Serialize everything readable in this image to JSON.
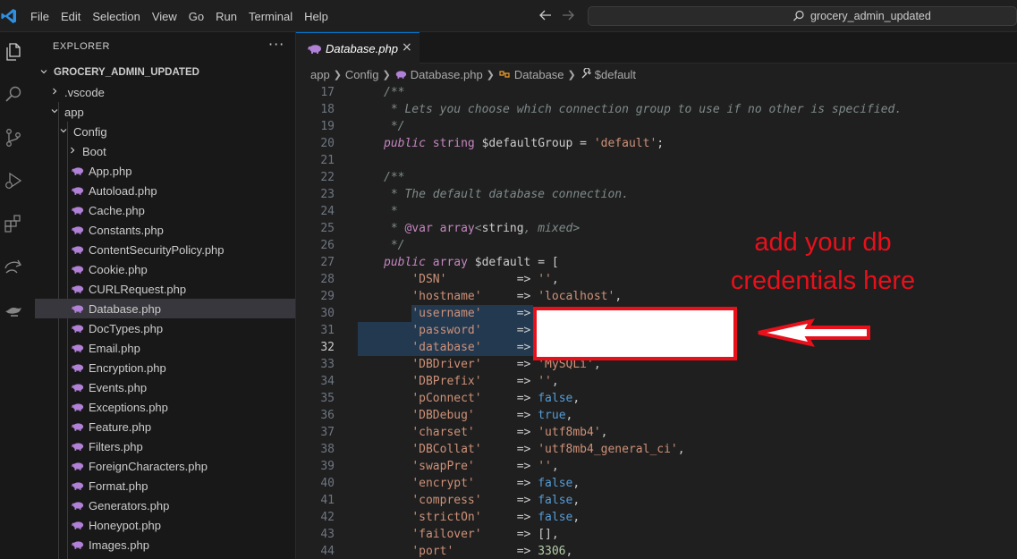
{
  "menu": [
    "File",
    "Edit",
    "Selection",
    "View",
    "Go",
    "Run",
    "Terminal",
    "Help"
  ],
  "search": {
    "text": "grocery_admin_updated"
  },
  "sidebar": {
    "title": "EXPLORER",
    "more": "···",
    "root": "GROCERY_ADMIN_UPDATED",
    "items": [
      {
        "label": ".vscode",
        "kind": "folder-collapsed"
      },
      {
        "label": "app",
        "kind": "folder-open"
      },
      {
        "label": "Config",
        "kind": "folder-open"
      },
      {
        "label": "Boot",
        "kind": "folder-collapsed"
      },
      {
        "label": "App.php",
        "kind": "php"
      },
      {
        "label": "Autoload.php",
        "kind": "php"
      },
      {
        "label": "Cache.php",
        "kind": "php"
      },
      {
        "label": "Constants.php",
        "kind": "php"
      },
      {
        "label": "ContentSecurityPolicy.php",
        "kind": "php"
      },
      {
        "label": "Cookie.php",
        "kind": "php"
      },
      {
        "label": "CURLRequest.php",
        "kind": "php"
      },
      {
        "label": "Database.php",
        "kind": "php",
        "selected": true
      },
      {
        "label": "DocTypes.php",
        "kind": "php"
      },
      {
        "label": "Email.php",
        "kind": "php"
      },
      {
        "label": "Encryption.php",
        "kind": "php"
      },
      {
        "label": "Events.php",
        "kind": "php"
      },
      {
        "label": "Exceptions.php",
        "kind": "php"
      },
      {
        "label": "Feature.php",
        "kind": "php"
      },
      {
        "label": "Filters.php",
        "kind": "php"
      },
      {
        "label": "ForeignCharacters.php",
        "kind": "php"
      },
      {
        "label": "Format.php",
        "kind": "php"
      },
      {
        "label": "Generators.php",
        "kind": "php"
      },
      {
        "label": "Honeypot.php",
        "kind": "php"
      },
      {
        "label": "Images.php",
        "kind": "php"
      }
    ]
  },
  "tab": {
    "label": "Database.php",
    "close": "×"
  },
  "breadcrumb": {
    "app": "app",
    "config": "Config",
    "file": "Database.php",
    "class": "Database",
    "prop": "$default"
  },
  "code": {
    "active_line": "32",
    "lines": [
      {
        "n": "17",
        "t": [
          [
            "c-gray",
            "/**"
          ]
        ]
      },
      {
        "n": "18",
        "t": [
          [
            "c-gray",
            " * Lets you choose which connection group to use if no other is specified."
          ]
        ]
      },
      {
        "n": "19",
        "t": [
          [
            "c-gray",
            " */"
          ]
        ]
      },
      {
        "n": "20",
        "t": [
          [
            "c-kw",
            "public"
          ],
          [
            "c-op",
            " "
          ],
          [
            "c-type",
            "string"
          ],
          [
            "c-var",
            " $defaultGroup "
          ],
          [
            "c-op",
            "= "
          ],
          [
            "c-str",
            "'default'"
          ],
          [
            "c-op",
            ";"
          ]
        ]
      },
      {
        "n": "21",
        "t": []
      },
      {
        "n": "22",
        "t": [
          [
            "c-gray",
            "/**"
          ]
        ]
      },
      {
        "n": "23",
        "t": [
          [
            "c-gray",
            " * The default database connection."
          ]
        ]
      },
      {
        "n": "24",
        "t": [
          [
            "c-gray",
            " *"
          ]
        ]
      },
      {
        "n": "25",
        "t": [
          [
            "c-gray",
            " * "
          ],
          [
            "c-tag",
            "@var"
          ],
          [
            "c-op",
            " "
          ],
          [
            "c-type",
            "array"
          ],
          [
            "c-gray",
            "<"
          ],
          [
            "c-var",
            "string"
          ],
          [
            "c-gray",
            ", mixed>"
          ]
        ]
      },
      {
        "n": "26",
        "t": [
          [
            "c-gray",
            " */"
          ]
        ]
      },
      {
        "n": "27",
        "t": [
          [
            "c-kw",
            "public"
          ],
          [
            "c-op",
            " "
          ],
          [
            "c-type",
            "array"
          ],
          [
            "c-var",
            " $default "
          ],
          [
            "c-op",
            "= ["
          ]
        ]
      },
      {
        "n": "28",
        "t": [
          [
            "c-op",
            "    "
          ],
          [
            "c-str",
            "'DSN'"
          ],
          [
            "c-op",
            "          => "
          ],
          [
            "c-str",
            "''"
          ],
          [
            "c-op",
            ","
          ]
        ]
      },
      {
        "n": "29",
        "t": [
          [
            "c-op",
            "    "
          ],
          [
            "c-str",
            "'hostname'"
          ],
          [
            "c-op",
            "     => "
          ],
          [
            "c-str",
            "'localhost'"
          ],
          [
            "c-op",
            ","
          ]
        ]
      },
      {
        "n": "30",
        "t": [
          [
            "c-op",
            "    "
          ],
          [
            "c-str",
            "'username'"
          ],
          [
            "c-op",
            "     =>"
          ]
        ]
      },
      {
        "n": "31",
        "t": [
          [
            "c-op",
            "    "
          ],
          [
            "c-str",
            "'password'"
          ],
          [
            "c-op",
            "     =>"
          ]
        ]
      },
      {
        "n": "32",
        "t": [
          [
            "c-op",
            "    "
          ],
          [
            "c-str",
            "'database'"
          ],
          [
            "c-op",
            "     =>"
          ]
        ]
      },
      {
        "n": "33",
        "t": [
          [
            "c-op",
            "    "
          ],
          [
            "c-str",
            "'DBDriver'"
          ],
          [
            "c-op",
            "     => "
          ],
          [
            "c-str",
            "'MySQLi'"
          ],
          [
            "c-op",
            ","
          ]
        ]
      },
      {
        "n": "34",
        "t": [
          [
            "c-op",
            "    "
          ],
          [
            "c-str",
            "'DBPrefix'"
          ],
          [
            "c-op",
            "     => "
          ],
          [
            "c-str",
            "''"
          ],
          [
            "c-op",
            ","
          ]
        ]
      },
      {
        "n": "35",
        "t": [
          [
            "c-op",
            "    "
          ],
          [
            "c-str",
            "'pConnect'"
          ],
          [
            "c-op",
            "     => "
          ],
          [
            "c-bool",
            "false"
          ],
          [
            "c-op",
            ","
          ]
        ]
      },
      {
        "n": "36",
        "t": [
          [
            "c-op",
            "    "
          ],
          [
            "c-str",
            "'DBDebug'"
          ],
          [
            "c-op",
            "      => "
          ],
          [
            "c-bool",
            "true"
          ],
          [
            "c-op",
            ","
          ]
        ]
      },
      {
        "n": "37",
        "t": [
          [
            "c-op",
            "    "
          ],
          [
            "c-str",
            "'charset'"
          ],
          [
            "c-op",
            "      => "
          ],
          [
            "c-str",
            "'utf8mb4'"
          ],
          [
            "c-op",
            ","
          ]
        ]
      },
      {
        "n": "38",
        "t": [
          [
            "c-op",
            "    "
          ],
          [
            "c-str",
            "'DBCollat'"
          ],
          [
            "c-op",
            "     => "
          ],
          [
            "c-str",
            "'utf8mb4_general_ci'"
          ],
          [
            "c-op",
            ","
          ]
        ]
      },
      {
        "n": "39",
        "t": [
          [
            "c-op",
            "    "
          ],
          [
            "c-str",
            "'swapPre'"
          ],
          [
            "c-op",
            "      => "
          ],
          [
            "c-str",
            "''"
          ],
          [
            "c-op",
            ","
          ]
        ]
      },
      {
        "n": "40",
        "t": [
          [
            "c-op",
            "    "
          ],
          [
            "c-str",
            "'encrypt'"
          ],
          [
            "c-op",
            "      => "
          ],
          [
            "c-bool",
            "false"
          ],
          [
            "c-op",
            ","
          ]
        ]
      },
      {
        "n": "41",
        "t": [
          [
            "c-op",
            "    "
          ],
          [
            "c-str",
            "'compress'"
          ],
          [
            "c-op",
            "     => "
          ],
          [
            "c-bool",
            "false"
          ],
          [
            "c-op",
            ","
          ]
        ]
      },
      {
        "n": "42",
        "t": [
          [
            "c-op",
            "    "
          ],
          [
            "c-str",
            "'strictOn'"
          ],
          [
            "c-op",
            "     => "
          ],
          [
            "c-bool",
            "false"
          ],
          [
            "c-op",
            ","
          ]
        ]
      },
      {
        "n": "43",
        "t": [
          [
            "c-op",
            "    "
          ],
          [
            "c-str",
            "'failover'"
          ],
          [
            "c-op",
            "     => "
          ],
          [
            "c-op",
            "[],"
          ]
        ]
      },
      {
        "n": "44",
        "t": [
          [
            "c-op",
            "    "
          ],
          [
            "c-str",
            "'port'"
          ],
          [
            "c-op",
            "         => "
          ],
          [
            "c-num",
            "3306"
          ],
          [
            "c-op",
            ","
          ]
        ]
      }
    ]
  },
  "annotation": {
    "line1": "add your db",
    "line2": "credentials here"
  },
  "colors": {
    "accent": "#0078d4",
    "annotation": "#e8101b",
    "php": "#b180d7"
  }
}
